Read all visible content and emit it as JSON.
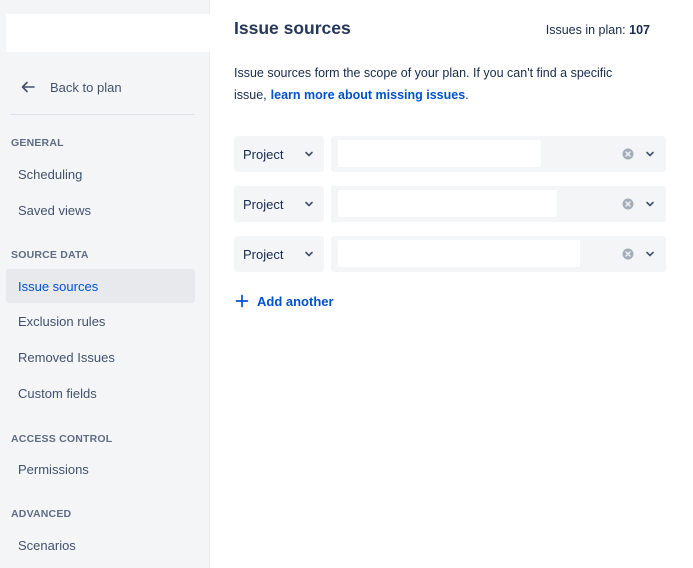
{
  "sidebar": {
    "back_label": "Back to plan",
    "sections": [
      {
        "title": "GENERAL",
        "items": [
          {
            "label": "Scheduling"
          },
          {
            "label": "Saved views"
          }
        ]
      },
      {
        "title": "SOURCE DATA",
        "items": [
          {
            "label": "Issue sources",
            "active": true
          },
          {
            "label": "Exclusion rules"
          },
          {
            "label": "Removed Issues"
          },
          {
            "label": "Custom fields"
          }
        ]
      },
      {
        "title": "ACCESS CONTROL",
        "items": [
          {
            "label": "Permissions"
          }
        ]
      },
      {
        "title": "ADVANCED",
        "items": [
          {
            "label": "Scenarios"
          }
        ]
      }
    ]
  },
  "main": {
    "title": "Issue sources",
    "count_label": "Issues in plan:",
    "count_value": "107",
    "description": "Issue sources form the scope of your plan. If you can't find a specific issue,",
    "description_link": "learn more about missing issues",
    "description_end": ".",
    "rows": [
      {
        "type": "Project",
        "value": ""
      },
      {
        "type": "Project",
        "value": ""
      },
      {
        "type": "Project",
        "value": ""
      }
    ],
    "add_another_label": "Add another"
  },
  "colors": {
    "accent": "#0052cc",
    "sidebar_bg": "#f4f5f7",
    "active_item_bg": "#e8e9ec",
    "text": "#172b4d"
  },
  "icons": {
    "back": "arrow-left-icon",
    "dropdown": "chevron-down-icon",
    "clear": "clear-circle-icon",
    "add": "plus-icon"
  }
}
